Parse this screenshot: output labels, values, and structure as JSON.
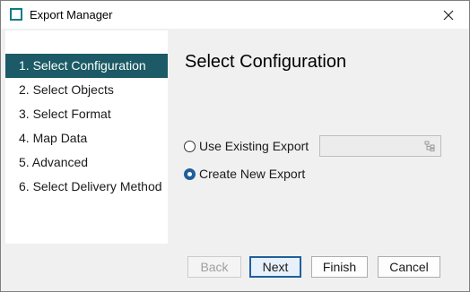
{
  "window": {
    "title": "Export Manager"
  },
  "steps": [
    {
      "label": "1. Select Configuration",
      "active": true
    },
    {
      "label": "2. Select Objects",
      "active": false
    },
    {
      "label": "3. Select Format",
      "active": false
    },
    {
      "label": "4. Map Data",
      "active": false
    },
    {
      "label": "5. Advanced",
      "active": false
    },
    {
      "label": "6. Select Delivery Method",
      "active": false
    }
  ],
  "main": {
    "title": "Select Configuration",
    "options": [
      {
        "label": "Use Existing Export",
        "selected": false
      },
      {
        "label": "Create New Export",
        "selected": true
      }
    ],
    "existing_export_value": ""
  },
  "buttons": {
    "back": "Back",
    "next": "Next",
    "finish": "Finish",
    "cancel": "Cancel"
  },
  "icons": {
    "app": "app-window-icon",
    "close": "close-icon",
    "picker": "tree-browse-icon"
  },
  "colors": {
    "active_step_bg": "#1b5a66",
    "accent": "#1f5f9c",
    "app_icon": "#0e7c86"
  }
}
